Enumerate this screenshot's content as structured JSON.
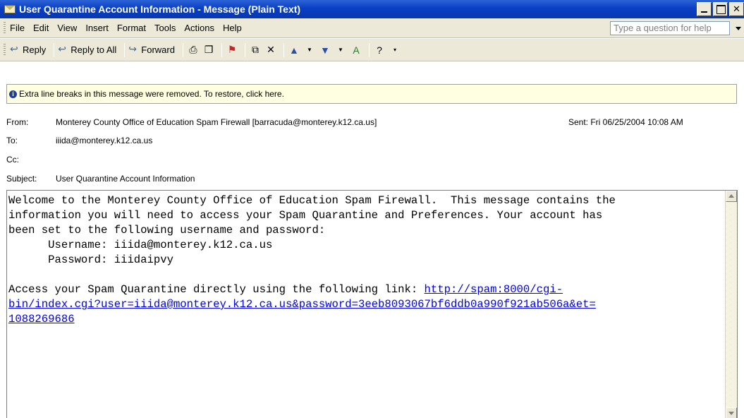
{
  "window": {
    "title": "User Quarantine Account Information - Message (Plain Text)"
  },
  "menu": {
    "items": [
      "File",
      "Edit",
      "View",
      "Insert",
      "Format",
      "Tools",
      "Actions",
      "Help"
    ],
    "help_placeholder": "Type a question for help"
  },
  "toolbar": {
    "reply": "Reply",
    "reply_all": "Reply to All",
    "forward": "Forward"
  },
  "infobar": {
    "text": "Extra line breaks in this message were removed. To restore, click here."
  },
  "header": {
    "from_label": "From:",
    "from_value": "Monterey County Office of Education Spam Firewall [barracuda@monterey.k12.ca.us]",
    "sent": "Sent: Fri 06/25/2004 10:08 AM",
    "to_label": "To:",
    "to_value": "iiida@monterey.k12.ca.us",
    "cc_label": "Cc:",
    "cc_value": "",
    "subject_label": "Subject:",
    "subject_value": "User Quarantine Account Information"
  },
  "message": {
    "line1": "Welcome to the Monterey County Office of Education Spam Firewall.  This message contains the",
    "line2": "information you will need to access your Spam Quarantine and Preferences. Your account has",
    "line3": "been set to the following username and password:",
    "line4": "      Username: iiida@monterey.k12.ca.us",
    "line5": "      Password: iiidaipvy",
    "line7_prefix": "Access your Spam Quarantine directly using the following link: ",
    "link_part1": "http://spam:8000/cgi-",
    "link_part2": "bin/index.cgi?user=iiida@monterey.k12.ca.us&password=3eeb8093067bf6ddb0a990f921ab506a&et=",
    "link_part3": "1088269686"
  }
}
